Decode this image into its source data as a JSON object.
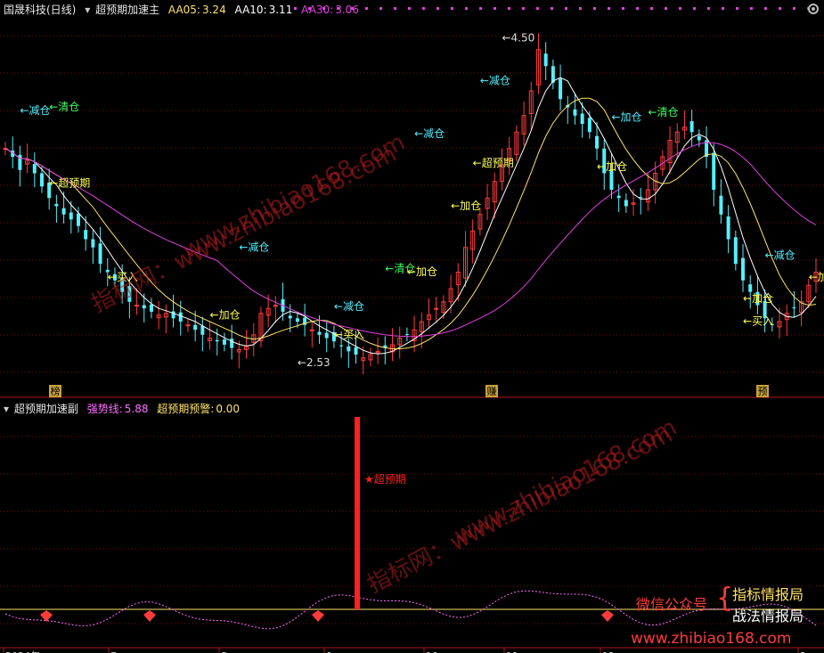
{
  "main_header": {
    "stock": "国晟科技(日线)",
    "indicator": "超预期加速主",
    "aa05_label": "AA05:",
    "aa05_value": "3.24",
    "aa10_label": "AA10:",
    "aa10_value": "3.11",
    "aa30_label": "AA30:",
    "aa30_value": "3.06"
  },
  "sub_header": {
    "indicator": "超预期加速副",
    "strong_label": "强势线:",
    "strong_value": "5.88",
    "warn_label": "超预期预警:",
    "warn_value": "0.00"
  },
  "badges": [
    "榜",
    "赚",
    "预"
  ],
  "date_labels": [
    "2024年",
    "7",
    "8",
    "9",
    "10",
    "11",
    "12",
    "2"
  ],
  "promo": {
    "wechat": "微信公众号",
    "line1": "指标情报局",
    "line2": "战法情报局",
    "site": "www.zhibiao168.com"
  },
  "watermarks": [
    "www.zhibiao168.com",
    "指标网：www.zhibiao168.com",
    "www.zhibiao168.com",
    "指标网：www.zhibiao168.com"
  ],
  "colors": {
    "up": "#ff3b3b",
    "down": "#54f0ff",
    "ma5": "#ffffff",
    "ma10": "#ffe36b",
    "ma30": "#e040e0",
    "signal": "#ffff55",
    "cut": "#54f0ff",
    "clear": "#40ff60",
    "strong": "#ff6cff",
    "warn": "#ff2020"
  },
  "chart_data": [
    {
      "type": "candlestick",
      "title": "超预期加速主",
      "ylim": [
        2.4,
        4.6
      ],
      "highlights": {
        "max": {
          "label": "4.50",
          "value": 4.5
        },
        "min": {
          "label": "2.53",
          "value": 2.53
        }
      },
      "series_close": [
        3.85,
        3.8,
        3.72,
        3.78,
        3.7,
        3.62,
        3.55,
        3.5,
        3.45,
        3.42,
        3.38,
        3.3,
        3.25,
        3.15,
        3.1,
        3.05,
        2.98,
        2.92,
        2.9,
        2.88,
        2.86,
        2.84,
        2.85,
        2.82,
        2.8,
        2.78,
        2.75,
        2.72,
        2.7,
        2.68,
        2.66,
        2.64,
        2.63,
        2.65,
        2.72,
        2.85,
        2.88,
        2.9,
        2.86,
        2.82,
        2.8,
        2.78,
        2.75,
        2.72,
        2.7,
        2.68,
        2.65,
        2.62,
        2.6,
        2.58,
        2.6,
        2.62,
        2.64,
        2.66,
        2.7,
        2.72,
        2.75,
        2.8,
        2.84,
        2.88,
        2.92,
        3.0,
        3.1,
        3.25,
        3.35,
        3.45,
        3.55,
        3.65,
        3.75,
        3.85,
        3.95,
        4.05,
        4.2,
        4.45,
        4.35,
        4.25,
        4.15,
        4.1,
        4.05,
        4.0,
        3.95,
        3.85,
        3.7,
        3.6,
        3.55,
        3.5,
        3.52,
        3.55,
        3.6,
        3.7,
        3.8,
        3.9,
        3.95,
        3.98,
        3.95,
        3.9,
        3.8,
        3.6,
        3.45,
        3.3,
        3.15,
        3.05,
        2.98,
        2.9,
        2.82,
        2.78,
        2.8,
        2.85,
        2.88,
        2.92,
        3.02,
        3.1
      ],
      "annotations": [
        {
          "text": "←清仓",
          "kind": "clear",
          "at": [
            13,
            4.08
          ]
        },
        {
          "text": "←减仓",
          "kind": "cut",
          "at": [
            5,
            4.06
          ]
        },
        {
          "text": "←超预期",
          "kind": "signal",
          "at": [
            13,
            3.62
          ]
        },
        {
          "text": "←买入",
          "kind": "signal",
          "at": [
            30,
            3.05
          ]
        },
        {
          "text": "←减仓",
          "kind": "cut",
          "at": [
            67,
            3.23
          ]
        },
        {
          "text": "←加仓",
          "kind": "signal",
          "at": [
            57,
            2.82
          ]
        },
        {
          "text": "←2.53",
          "kind": "price",
          "at": [
            82,
            2.53
          ]
        },
        {
          "text": "←减仓",
          "kind": "cut",
          "at": [
            94,
            2.87
          ]
        },
        {
          "text": "←清仓",
          "kind": "clear",
          "at": [
            108,
            3.1
          ]
        },
        {
          "text": "←加仓",
          "kind": "signal",
          "at": [
            113,
            3.08
          ]
        },
        {
          "text": "←买入",
          "kind": "signal",
          "at": [
            94,
            2.7
          ]
        },
        {
          "text": "←加仓",
          "kind": "signal",
          "at": [
            126,
            3.48
          ]
        },
        {
          "text": "←减仓",
          "kind": "cut",
          "at": [
            116,
            3.92
          ]
        },
        {
          "text": "←超预期",
          "kind": "signal",
          "at": [
            133,
            3.74
          ]
        },
        {
          "text": "←减仓",
          "kind": "cut",
          "at": [
            135,
            4.24
          ]
        },
        {
          "text": "←4.50",
          "kind": "price",
          "at": [
            140,
            4.5
          ]
        },
        {
          "text": "←加仓",
          "kind": "signal",
          "at": [
            167,
            3.72
          ]
        },
        {
          "text": "←加仓",
          "kind": "cut",
          "at": [
            172,
            4.02
          ]
        },
        {
          "text": "←清仓",
          "kind": "clear",
          "at": [
            182,
            4.05
          ]
        },
        {
          "text": "←减仓",
          "kind": "cut",
          "at": [
            216,
            3.18
          ]
        },
        {
          "text": "←加仓",
          "kind": "signal",
          "at": [
            210,
            2.92
          ]
        },
        {
          "text": "←买入",
          "kind": "signal",
          "at": [
            209,
            2.78
          ]
        },
        {
          "text": "←加",
          "kind": "signal",
          "at": [
            227,
            3.05
          ]
        }
      ]
    },
    {
      "type": "line",
      "title": "超预期加速副",
      "series": [
        {
          "name": "强势线",
          "value": 5.88
        },
        {
          "name": "超预期预警",
          "value": 0.0
        }
      ],
      "spike_label": "★超预期"
    }
  ]
}
